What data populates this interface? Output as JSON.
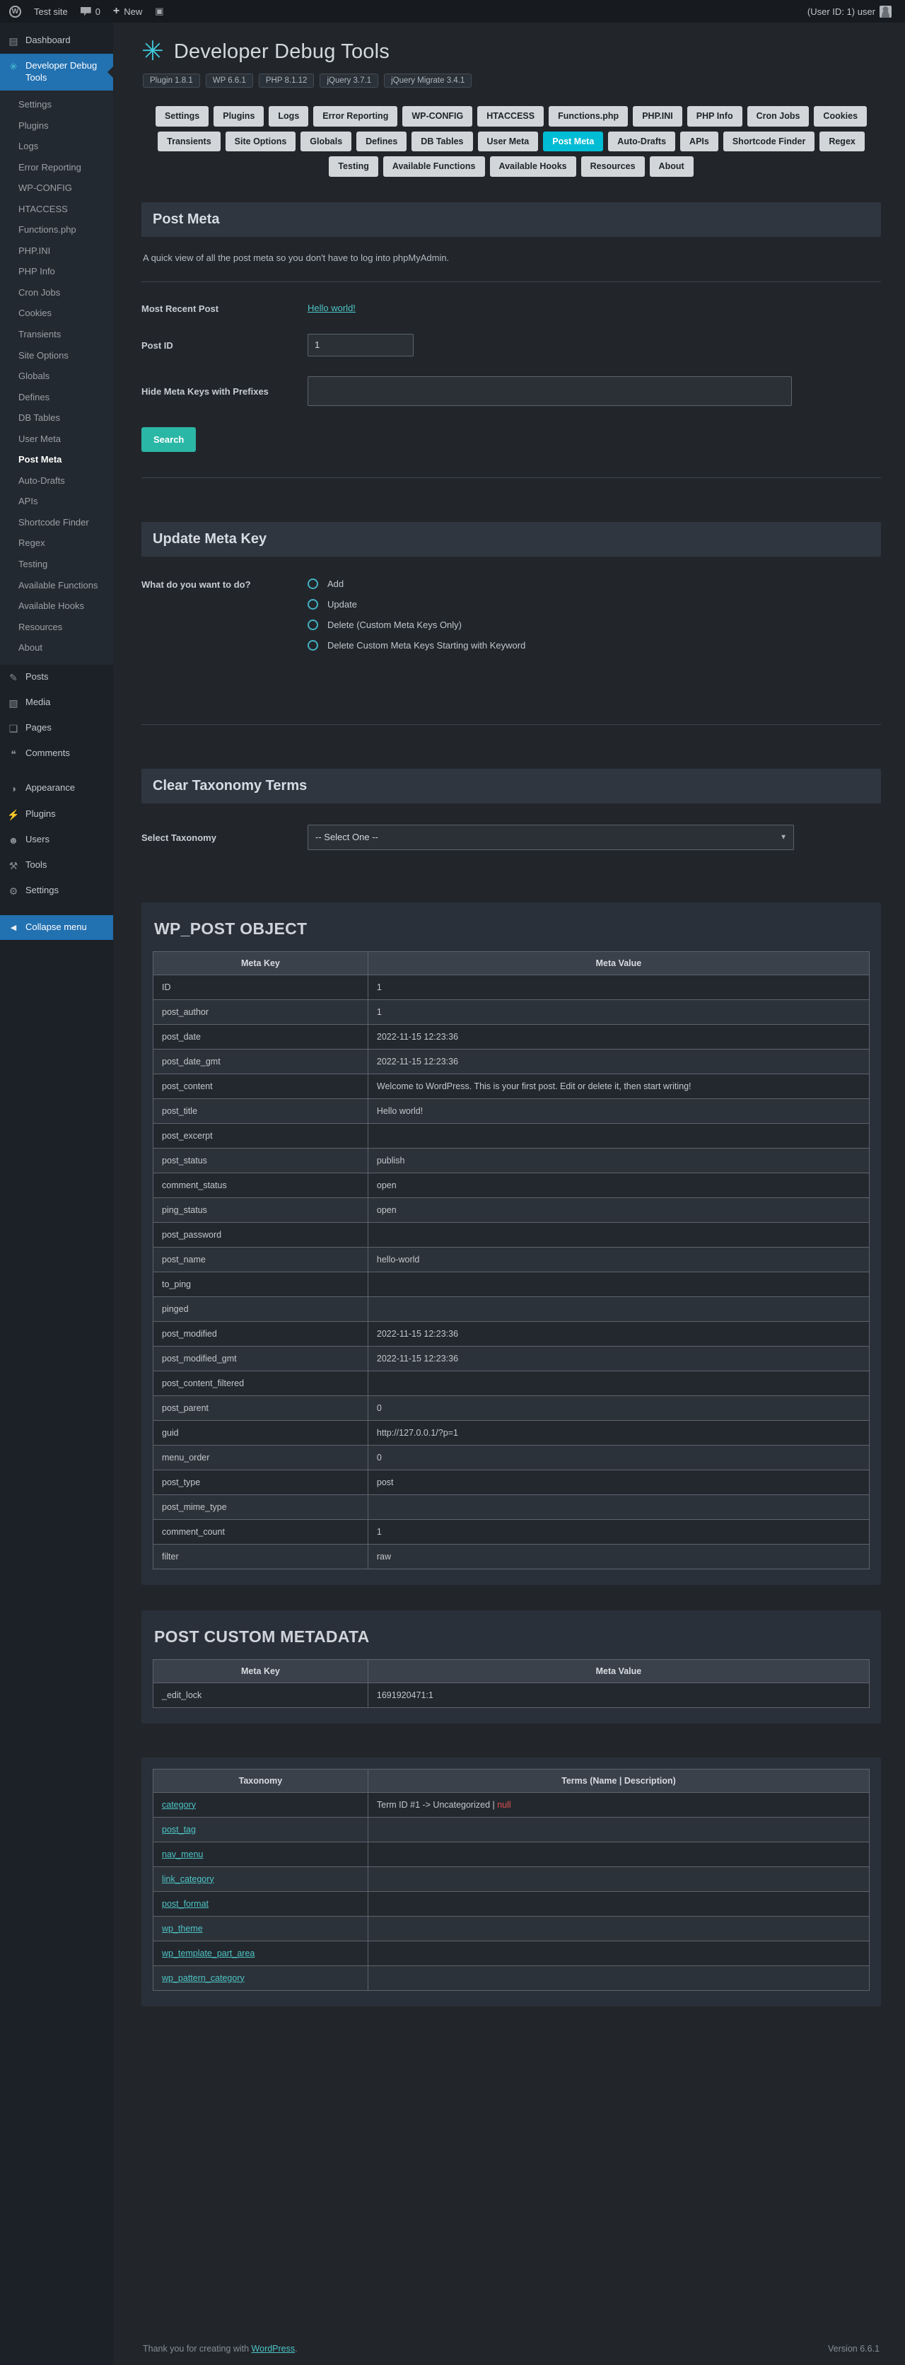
{
  "admin_bar": {
    "site_name": "Test site",
    "comment_count": "0",
    "new_label": "New",
    "user_text": "(User ID: 1) user"
  },
  "icons": {
    "wordpress-logo": "W",
    "plus-icon": "+",
    "adminbar-plugin-icon": "▣",
    "dashboard-icon": "▤",
    "debug-tools-icon": "✳",
    "posts-icon": "✎",
    "media-icon": "▧",
    "pages-icon": "❏",
    "comments-icon": "❝",
    "appearance-icon": "◑",
    "plugins-icon": "⚡",
    "users-icon": "☻",
    "tools-icon": "⚒",
    "settings-icon": "⚙",
    "collapse-icon": "◀",
    "select-arrow-icon": "▼"
  },
  "sidebar": {
    "dashboard": "Dashboard",
    "debug_tools": "Developer Debug Tools",
    "submenu": [
      "Settings",
      "Plugins",
      "Logs",
      "Error Reporting",
      "WP-CONFIG",
      "HTACCESS",
      "Functions.php",
      "PHP.INI",
      "PHP Info",
      "Cron Jobs",
      "Cookies",
      "Transients",
      "Site Options",
      "Globals",
      "Defines",
      "DB Tables",
      "User Meta",
      "Post Meta",
      "Auto-Drafts",
      "APIs",
      "Shortcode Finder",
      "Regex",
      "Testing",
      "Available Functions",
      "Available Hooks",
      "Resources",
      "About"
    ],
    "submenu_current": "Post Meta",
    "posts": "Posts",
    "media": "Media",
    "pages": "Pages",
    "comments": "Comments",
    "appearance": "Appearance",
    "plugins": "Plugins",
    "users": "Users",
    "tools": "Tools",
    "settings": "Settings",
    "collapse": "Collapse menu"
  },
  "header": {
    "title": "Developer Debug Tools",
    "badges": [
      "Plugin 1.8.1",
      "WP 6.6.1",
      "PHP 8.1.12",
      "jQuery 3.7.1",
      "jQuery Migrate 3.4.1"
    ]
  },
  "tabs": [
    "Settings",
    "Plugins",
    "Logs",
    "Error Reporting",
    "WP-CONFIG",
    "HTACCESS",
    "Functions.php",
    "PHP.INI",
    "PHP Info",
    "Cron Jobs",
    "Cookies",
    "Transients",
    "Site Options",
    "Globals",
    "Defines",
    "DB Tables",
    "User Meta",
    "Post Meta",
    "Auto-Drafts",
    "APIs",
    "Shortcode Finder",
    "Regex",
    "Testing",
    "Available Functions",
    "Available Hooks",
    "Resources",
    "About"
  ],
  "active_tab": "Post Meta",
  "post_meta_section": {
    "title": "Post Meta",
    "description": "A quick view of all the post meta so you don't have to log into phpMyAdmin.",
    "most_recent_label": "Most Recent Post",
    "most_recent_link": "Hello world!",
    "post_id_label": "Post ID",
    "post_id_value": "1",
    "hide_prefix_label": "Hide Meta Keys with Prefixes",
    "hide_prefix_value": "",
    "search_button": "Search"
  },
  "update_meta_section": {
    "title": "Update Meta Key",
    "question_label": "What do you want to do?",
    "options": [
      "Add",
      "Update",
      "Delete (Custom Meta Keys Only)",
      "Delete Custom Meta Keys Starting with Keyword"
    ]
  },
  "clear_taxonomy_section": {
    "title": "Clear Taxonomy Terms",
    "select_label": "Select Taxonomy",
    "select_value": "-- Select One --"
  },
  "wp_post_table": {
    "title": "WP_POST OBJECT",
    "headers": [
      "Meta Key",
      "Meta Value"
    ],
    "rows": [
      [
        "ID",
        "1"
      ],
      [
        "post_author",
        "1"
      ],
      [
        "post_date",
        "2022-11-15 12:23:36"
      ],
      [
        "post_date_gmt",
        "2022-11-15 12:23:36"
      ],
      [
        "post_content",
        "Welcome to WordPress. This is your first post. Edit or delete it, then start writing!"
      ],
      [
        "post_title",
        "Hello world!"
      ],
      [
        "post_excerpt",
        ""
      ],
      [
        "post_status",
        "publish"
      ],
      [
        "comment_status",
        "open"
      ],
      [
        "ping_status",
        "open"
      ],
      [
        "post_password",
        ""
      ],
      [
        "post_name",
        "hello-world"
      ],
      [
        "to_ping",
        ""
      ],
      [
        "pinged",
        ""
      ],
      [
        "post_modified",
        "2022-11-15 12:23:36"
      ],
      [
        "post_modified_gmt",
        "2022-11-15 12:23:36"
      ],
      [
        "post_content_filtered",
        ""
      ],
      [
        "post_parent",
        "0"
      ],
      [
        "guid",
        "http://127.0.0.1/?p=1"
      ],
      [
        "menu_order",
        "0"
      ],
      [
        "post_type",
        "post"
      ],
      [
        "post_mime_type",
        ""
      ],
      [
        "comment_count",
        "1"
      ],
      [
        "filter",
        "raw"
      ]
    ]
  },
  "custom_meta_table": {
    "title": "POST CUSTOM METADATA",
    "headers": [
      "Meta Key",
      "Meta Value"
    ],
    "rows": [
      [
        "_edit_lock",
        "1691920471:1"
      ]
    ]
  },
  "taxonomy_table": {
    "headers": [
      "Taxonomy",
      "Terms (Name | Description)"
    ],
    "rows": [
      {
        "taxonomy": "category",
        "terms": "Term ID #1 -> Uncategorized | ",
        "null_text": "null"
      },
      {
        "taxonomy": "post_tag",
        "terms": "",
        "null_text": ""
      },
      {
        "taxonomy": "nav_menu",
        "terms": "",
        "null_text": ""
      },
      {
        "taxonomy": "link_category",
        "terms": "",
        "null_text": ""
      },
      {
        "taxonomy": "post_format",
        "terms": "",
        "null_text": ""
      },
      {
        "taxonomy": "wp_theme",
        "terms": "",
        "null_text": ""
      },
      {
        "taxonomy": "wp_template_part_area",
        "terms": "",
        "null_text": ""
      },
      {
        "taxonomy": "wp_pattern_category",
        "terms": "",
        "null_text": ""
      }
    ]
  },
  "footer": {
    "thanks_prefix": "Thank you for creating with ",
    "wordpress_link": "WordPress",
    "thanks_suffix": ".",
    "version": "Version 6.6.1"
  },
  "colors": {
    "accent_teal": "#4cc4c4",
    "active_tab_cyan": "#00bcd4",
    "search_button_teal": "#2bb7a6",
    "menu_highlight_blue": "#2271b1",
    "null_red": "#e0514f"
  }
}
